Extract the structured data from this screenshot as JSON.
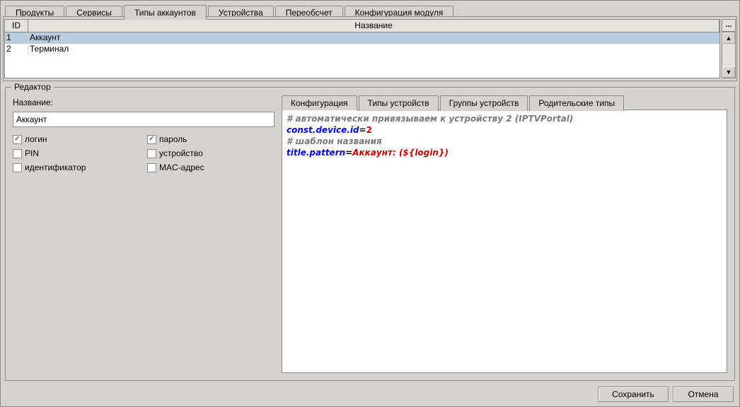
{
  "tabs_top": [
    {
      "label": "Продукты",
      "selected": false
    },
    {
      "label": "Сервисы",
      "selected": false
    },
    {
      "label": "Типы аккаунтов",
      "selected": true
    },
    {
      "label": "Устройства",
      "selected": false
    },
    {
      "label": "Переобсчет",
      "selected": false
    },
    {
      "label": "Конфигурация модуля",
      "selected": false
    }
  ],
  "table": {
    "headers": {
      "id": "ID",
      "name": "Название"
    },
    "more_btn": "...",
    "rows": [
      {
        "id": "1",
        "name": "Аккаунт",
        "selected": true
      },
      {
        "id": "2",
        "name": "Терминал",
        "selected": false
      }
    ]
  },
  "editor": {
    "legend": "Редактор",
    "name_label": "Название:",
    "name_value": "Аккаунт",
    "checkboxes": [
      {
        "label": "логин",
        "checked": true
      },
      {
        "label": "пароль",
        "checked": true
      },
      {
        "label": "PIN",
        "checked": false
      },
      {
        "label": "устройство",
        "checked": false
      },
      {
        "label": "идентификатор",
        "checked": false
      },
      {
        "label": "MAC-адрес",
        "checked": false
      }
    ],
    "inner_tabs": [
      {
        "label": "Конфигурация",
        "selected": true
      },
      {
        "label": "Типы устройств",
        "selected": false
      },
      {
        "label": "Группы устройств",
        "selected": false
      },
      {
        "label": "Родительские типы",
        "selected": false
      }
    ],
    "config_lines": [
      {
        "type": "comment",
        "text": "# автоматически привязываем к устройству 2 (IPTVPortal)"
      },
      {
        "type": "kv",
        "key": "const.device.id",
        "val": "2",
        "val_kind": "num"
      },
      {
        "type": "comment",
        "text": "# шаблон названия"
      },
      {
        "type": "kv",
        "key": "title.pattern",
        "val": "Аккаунт: (${login})",
        "val_kind": "str"
      }
    ]
  },
  "footer": {
    "save": "Сохранить",
    "cancel": "Отмена"
  }
}
